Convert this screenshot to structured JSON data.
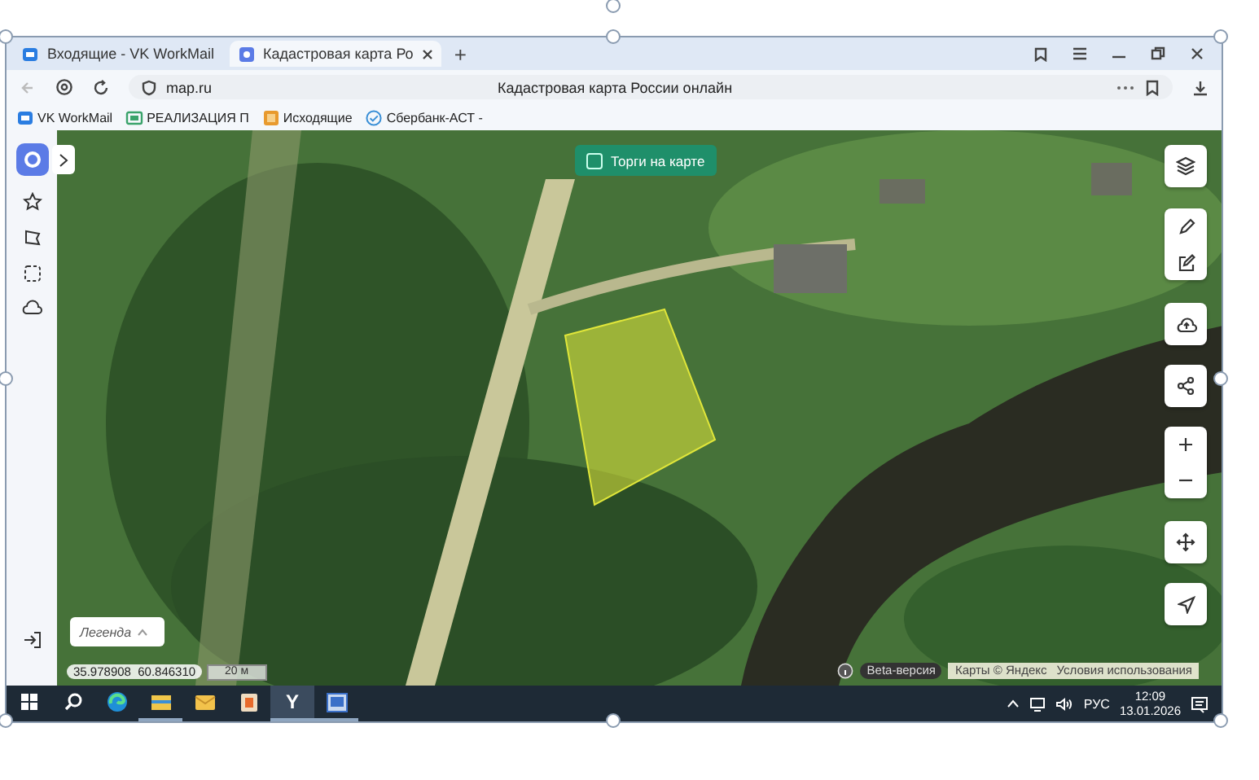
{
  "tabs": [
    {
      "label": "Входящие - VK WorkMail",
      "kind": "mail",
      "selected": false
    },
    {
      "label": "Кадастровая карта Ро",
      "kind": "map",
      "selected": true
    }
  ],
  "new_tab": "+",
  "address_bar": {
    "url": "map.ru",
    "page_title": "Кадастровая карта России онлайн"
  },
  "bookmarks": [
    {
      "label": "VK WorkMail",
      "kind": "mail"
    },
    {
      "label": "РЕАЛИЗАЦИЯ П",
      "kind": "folder"
    },
    {
      "label": "Исходящие",
      "kind": "outbox"
    },
    {
      "label": "Сбербанк-АСТ -",
      "kind": "check"
    }
  ],
  "map": {
    "auction_toggle": {
      "label": "Торги на карте",
      "checked": false
    },
    "legend": {
      "label": "Легенда",
      "expanded": false
    },
    "coordinates": "35.978908  60.846310",
    "scale": "20 м",
    "beta_label": "Beta-версия",
    "attribution": "Карты © Яндекс",
    "terms_link": "Условия использования"
  },
  "taskbar": {
    "apps": [
      {
        "kind": "edge",
        "running": false,
        "selected": false
      },
      {
        "kind": "explorer",
        "running": true,
        "selected": false
      },
      {
        "kind": "mail",
        "running": false,
        "selected": false
      },
      {
        "kind": "app",
        "running": false,
        "selected": false
      },
      {
        "kind": "browser",
        "glyph": "Y",
        "running": true,
        "selected": true
      },
      {
        "kind": "window",
        "running": true,
        "selected": false
      }
    ],
    "language": "РУС",
    "time": "12:09",
    "date": "13.01.2026"
  }
}
